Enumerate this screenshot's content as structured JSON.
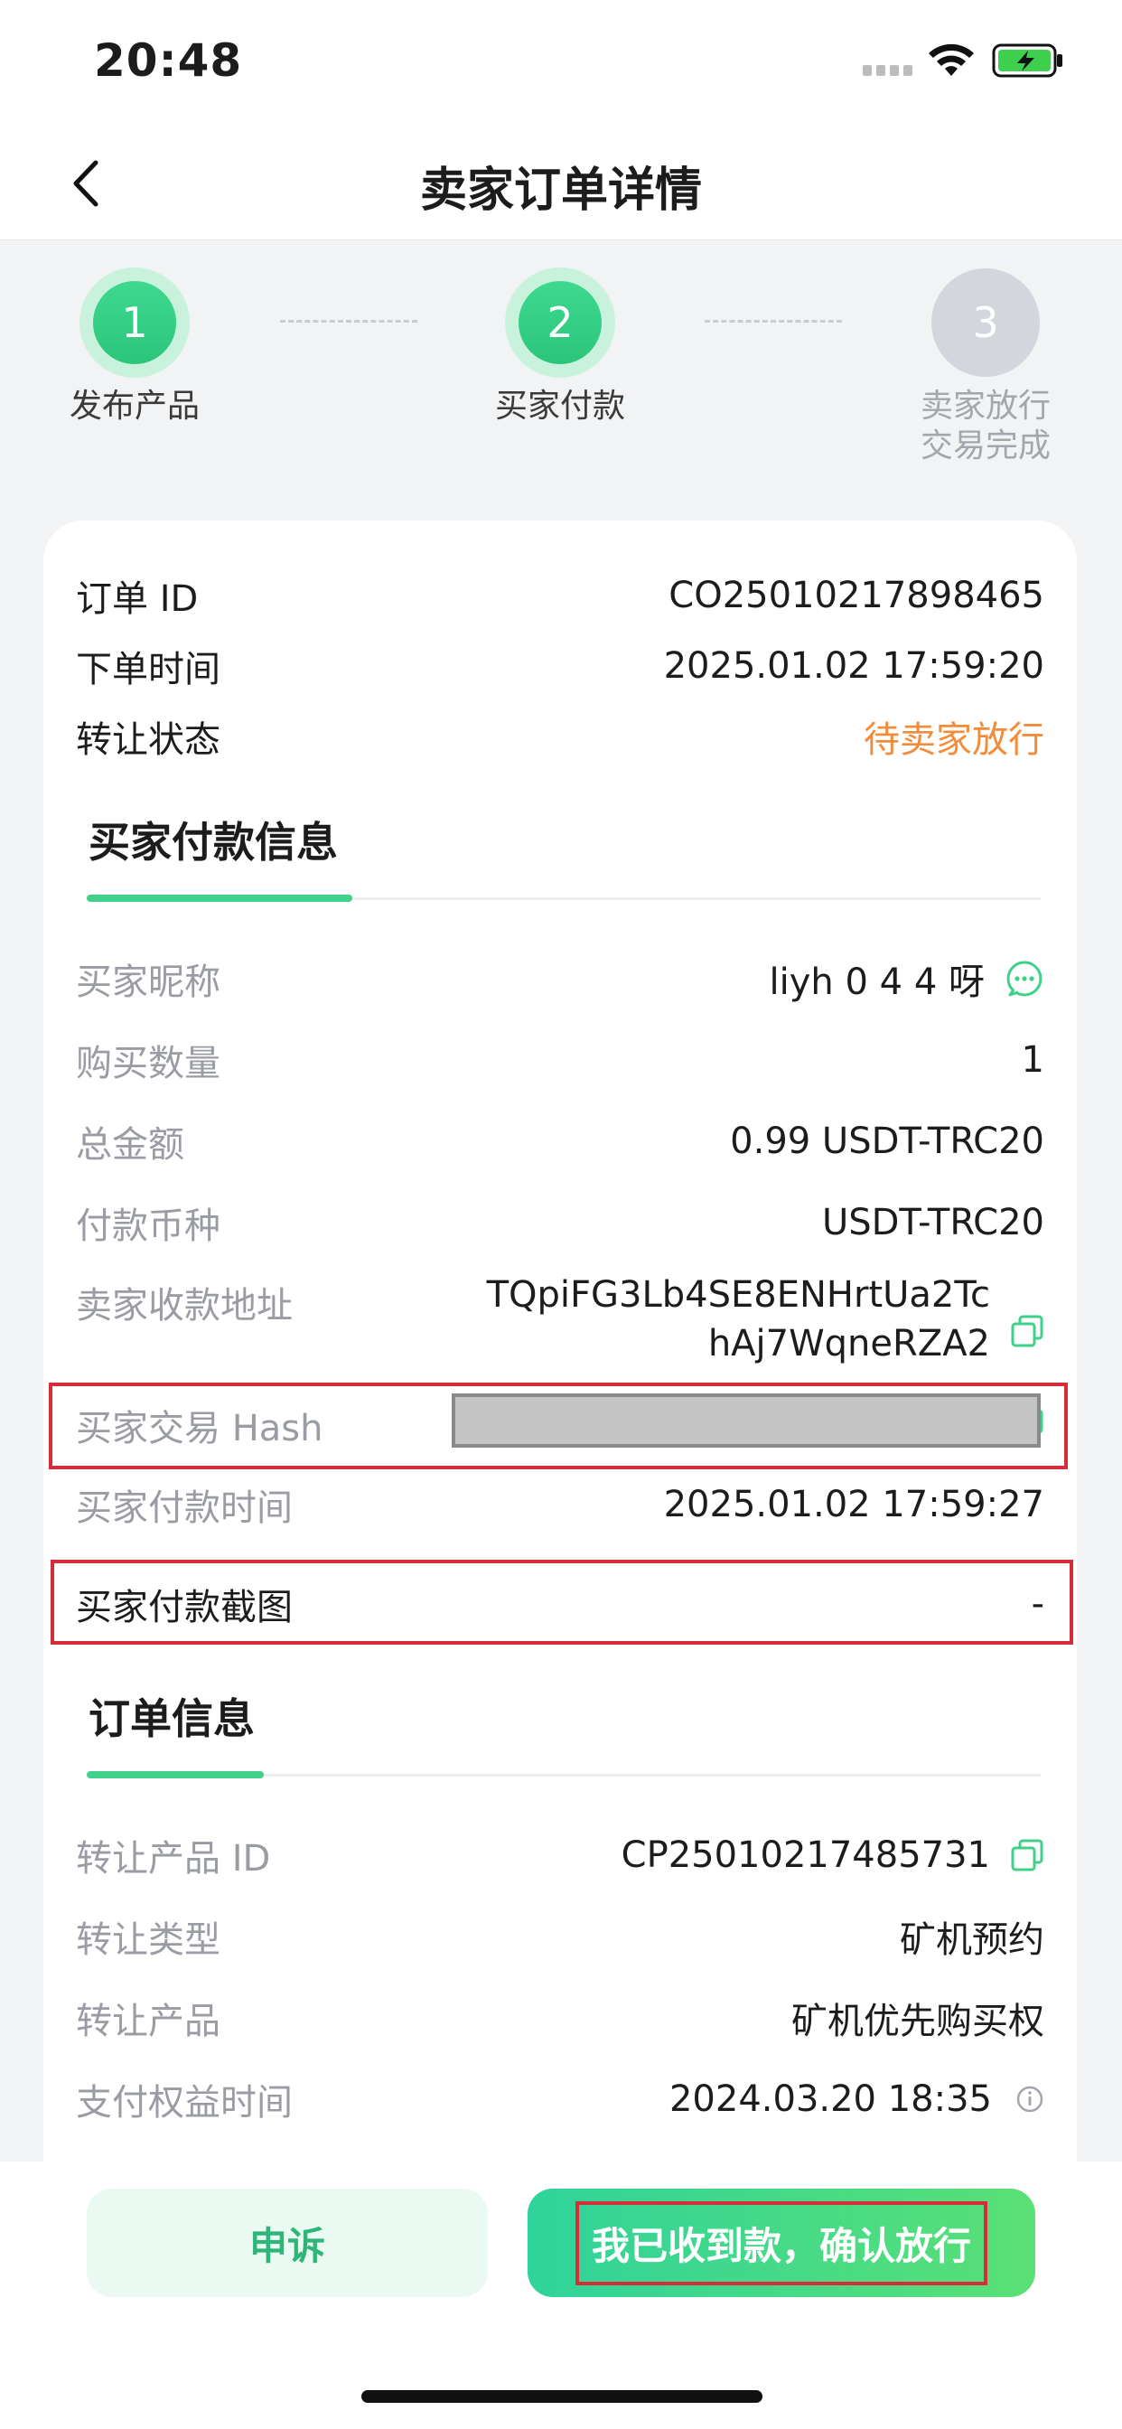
{
  "status_bar": {
    "time": "20:48"
  },
  "nav": {
    "title": "卖家订单详情"
  },
  "steps": [
    {
      "number": "1",
      "label": "发布产品"
    },
    {
      "number": "2",
      "label": "买家付款"
    },
    {
      "number": "3",
      "label_line1": "卖家放行",
      "label_line2": "交易完成"
    }
  ],
  "order_summary": {
    "order_id_label": "订单 ID",
    "order_id_value": "CO25010217898465",
    "order_time_label": "下单时间",
    "order_time_value": "2025.01.02 17:59:20",
    "status_label": "转让状态",
    "status_value": "待卖家放行"
  },
  "buyer_payment": {
    "section_title": "买家付款信息",
    "nickname_label": "买家昵称",
    "nickname_value": "liyh 0 4 4 呀",
    "quantity_label": "购买数量",
    "quantity_value": "1",
    "total_label": "总金额",
    "total_value": "0.99 USDT-TRC20",
    "currency_label": "付款币种",
    "currency_value": "USDT-TRC20",
    "address_label": "卖家收款地址",
    "address_line1": "TQpiFG3Lb4SE8ENHrtUa2Tc",
    "address_line2": "hAj7WqneRZA2",
    "hash_label": "买家交易 Hash",
    "pay_time_label": "买家付款时间",
    "pay_time_value": "2025.01.02 17:59:27",
    "screenshot_label": "买家付款截图",
    "screenshot_value": "-"
  },
  "order_info": {
    "section_title": "订单信息",
    "product_id_label": "转让产品 ID",
    "product_id_value": "CP25010217485731",
    "type_label": "转让类型",
    "type_value": "矿机预约",
    "product_label": "转让产品",
    "product_value": "矿机优先购买权",
    "benefit_time_label": "支付权益时间",
    "benefit_time_value": "2024.03.20 18:35"
  },
  "actions": {
    "appeal_label": "申诉",
    "confirm_label": "我已收到款，确认放行"
  },
  "colors": {
    "accent_green": "#3fd08a",
    "status_orange": "#f28b3a",
    "annotation_red": "#d62d3a"
  }
}
